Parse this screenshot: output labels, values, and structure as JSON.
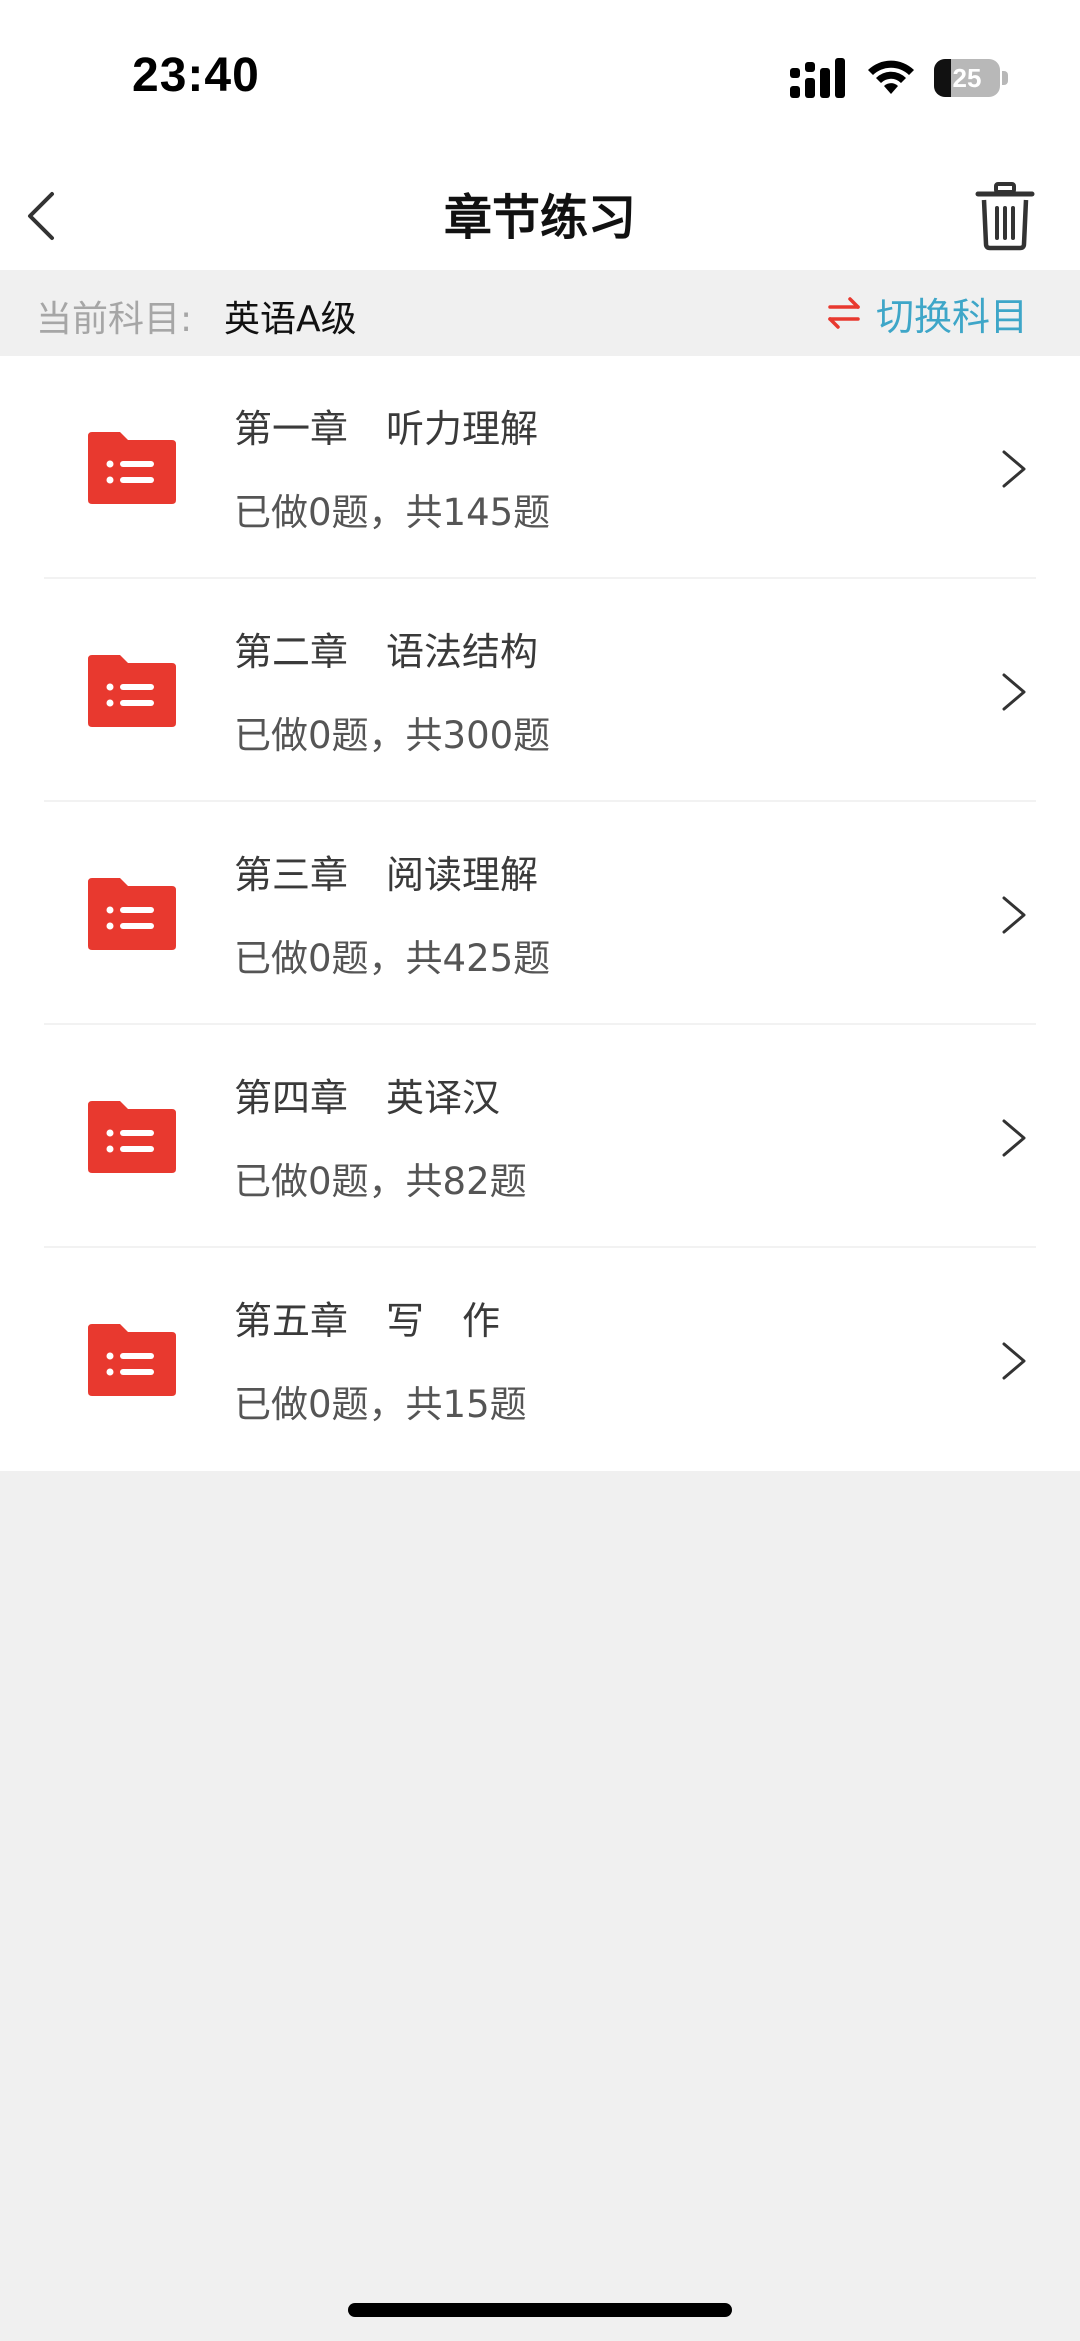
{
  "status_bar": {
    "time": "23:40",
    "battery_level": "25",
    "battery_fraction": 0.25,
    "icons": [
      "signal-icon",
      "wifi-icon",
      "battery-icon"
    ]
  },
  "nav": {
    "title": "章节练习",
    "back_icon": "chevron-left-icon",
    "trash_icon": "trash-icon"
  },
  "subject": {
    "label": "当前科目:",
    "value": "英语A级",
    "switch_label": "切换科目",
    "switch_icon": "swap-arrows-icon"
  },
  "chapters": [
    {
      "title": "第一章　听力理解",
      "progress": "已做0题，共145题"
    },
    {
      "title": "第二章　语法结构",
      "progress": "已做0题，共300题"
    },
    {
      "title": "第三章　阅读理解",
      "progress": "已做0题，共425题"
    },
    {
      "title": "第四章　英译汉",
      "progress": "已做0题，共82题"
    },
    {
      "title": "第五章　写　作",
      "progress": "已做0题，共15题"
    }
  ],
  "colors": {
    "folder_red": "#e8392f",
    "switch_blue": "#3ea6c8",
    "switch_icon_red": "#e8392f",
    "background": "#f0f0f0"
  }
}
